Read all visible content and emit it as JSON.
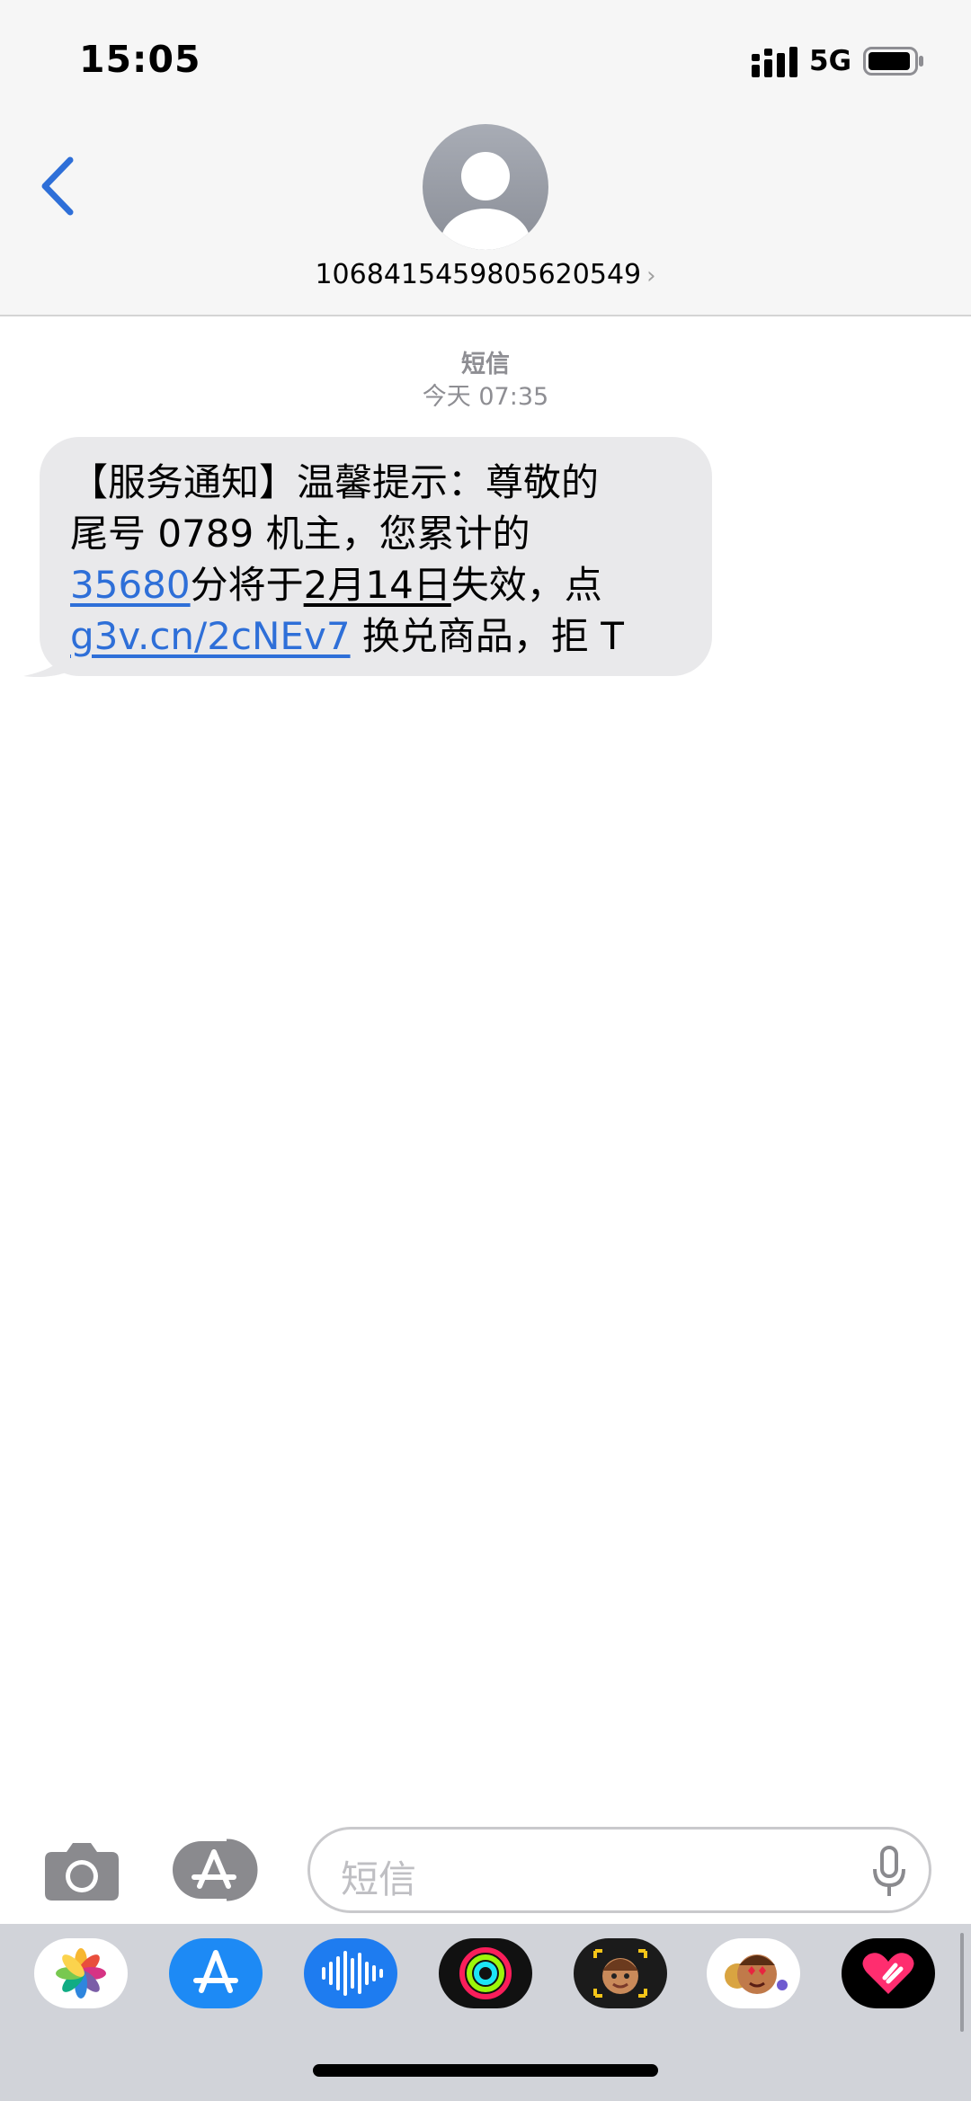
{
  "status_bar": {
    "time": "15:05",
    "network": "5G",
    "signal_bars": 4,
    "battery_level": 0.85
  },
  "header": {
    "contact": "1068415459805620549",
    "chevron": "›",
    "back_icon": "chevron-left-icon",
    "avatar_icon": "person-avatar-icon"
  },
  "thread": {
    "channel": "短信",
    "timestamp": "今天 07:35",
    "message": {
      "l1": "【服务通知】温馨提示：尊敬的",
      "l2": "尾号 0789 机主，您累计的",
      "l3_link": "35680",
      "l3_mid": "分将于",
      "l3_date": "2月14日",
      "l3_end": "失效，点",
      "l4_link": "g3v.cn/2cNEv7",
      "l4_end": " 换兑商品，拒 T"
    }
  },
  "input_bar": {
    "placeholder": "短信",
    "camera_icon": "camera-icon",
    "apps_icon": "app-store-icon",
    "mic_icon": "microphone-icon"
  },
  "app_drawer": {
    "apps": [
      "photos-icon",
      "app-store-icon",
      "audio-message-icon",
      "activity-icon",
      "memoji-icon",
      "animoji-icon",
      "digital-touch-icon"
    ]
  },
  "colors": {
    "accent": "#2e6fd8",
    "bubble": "#e9e9eb",
    "header_bg": "#f6f6f6"
  }
}
